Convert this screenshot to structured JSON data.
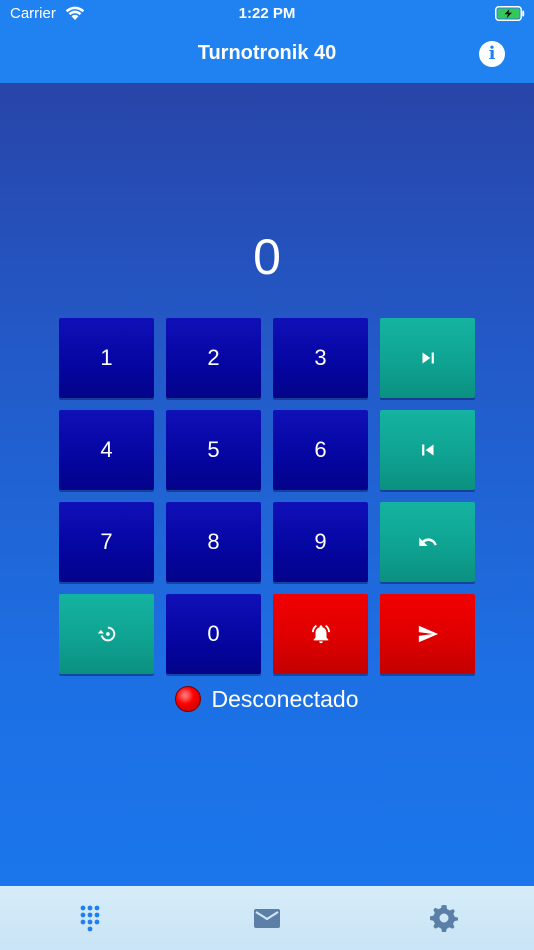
{
  "status_bar": {
    "carrier": "Carrier",
    "time": "1:22 PM",
    "icons": [
      "wifi-icon",
      "battery-charging-icon"
    ]
  },
  "nav": {
    "title": "Turnotronik 40",
    "info_label": "i",
    "info_icon": "info-icon"
  },
  "display": {
    "value": "0"
  },
  "keypad": {
    "rows": [
      [
        {
          "label": "1",
          "kind": "num"
        },
        {
          "label": "2",
          "kind": "num"
        },
        {
          "label": "3",
          "kind": "num"
        },
        {
          "icon": "skip-next-icon",
          "kind": "teal"
        }
      ],
      [
        {
          "label": "4",
          "kind": "num"
        },
        {
          "label": "5",
          "kind": "num"
        },
        {
          "label": "6",
          "kind": "num"
        },
        {
          "icon": "skip-previous-icon",
          "kind": "teal"
        }
      ],
      [
        {
          "label": "7",
          "kind": "num"
        },
        {
          "label": "8",
          "kind": "num"
        },
        {
          "label": "9",
          "kind": "num"
        },
        {
          "icon": "undo-icon",
          "kind": "teal"
        }
      ],
      [
        {
          "icon": "restore-icon",
          "kind": "teal"
        },
        {
          "label": "0",
          "kind": "num"
        },
        {
          "icon": "bell-alarm-icon",
          "kind": "red"
        },
        {
          "icon": "send-icon",
          "kind": "red"
        }
      ]
    ]
  },
  "connection": {
    "status": "Desconectado",
    "indicator_color": "#ff0000"
  },
  "tabs": [
    {
      "icon": "dialpad-icon",
      "selected": true
    },
    {
      "icon": "mail-icon",
      "selected": false
    },
    {
      "icon": "gear-icon",
      "selected": false
    }
  ],
  "colors": {
    "nav_bar": "#1f82f0",
    "key_number": "#0808a8",
    "key_teal": "#10a898",
    "key_red": "#e00000",
    "tab_active": "#1f7ff0",
    "tab_inactive": "#5b7fa6"
  }
}
